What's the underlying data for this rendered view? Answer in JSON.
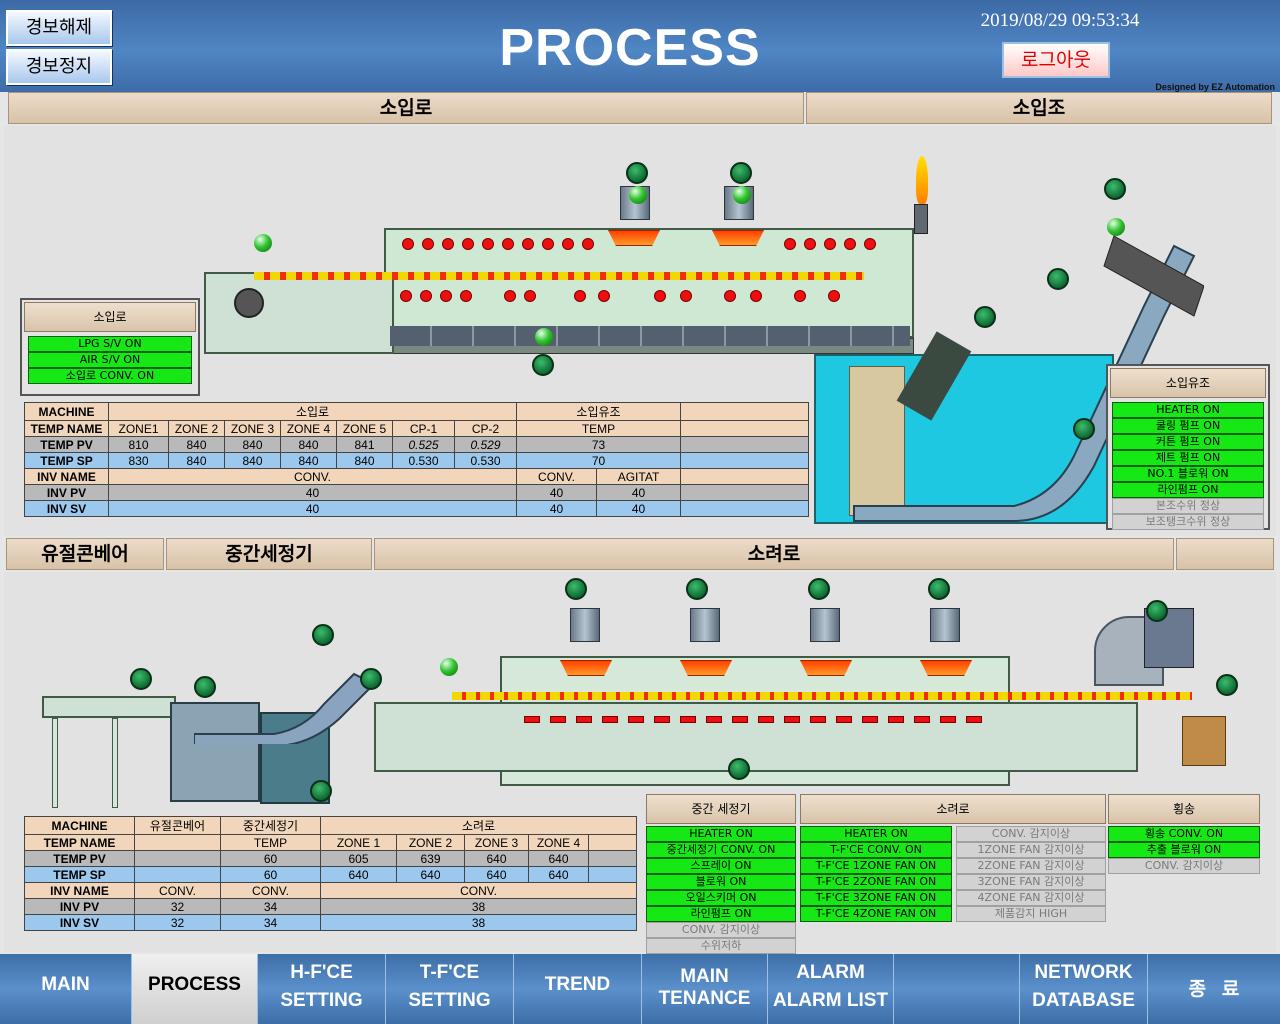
{
  "header": {
    "alarm_reset": "경보해제",
    "alarm_stop": "경보정지",
    "title": "PROCESS",
    "datetime": "2019/08/29 09:53:34",
    "logout": "로그아웃",
    "designed_by": "Designed by EZ Automation"
  },
  "sections": {
    "top_left": "소입로",
    "top_right": "소입조",
    "bottom_1": "유절콘베어",
    "bottom_2": "중간세정기",
    "bottom_3": "소려로"
  },
  "panels": {
    "quench_furnace": {
      "title": "소입로",
      "items": [
        "LPG S/V ON",
        "AIR S/V ON",
        "소입로 CONV. ON"
      ]
    },
    "quench_oil": {
      "title": "소입유조",
      "items_on": [
        "HEATER ON",
        "쿨링 펌프 ON",
        "커튼 펌프 ON",
        "제트 펌프 ON",
        "NO.1 블로워 ON",
        "라인펌프 ON"
      ],
      "items_off": [
        "본조수위 정상",
        "보조탱크수위 정상"
      ]
    },
    "washer": {
      "title": "중간 세정기",
      "items_on": [
        "HEATER ON",
        "중간세정기 CONV. ON",
        "스프레이 ON",
        "블로워 ON",
        "오일스키머 ON",
        "라인펌프 ON"
      ],
      "items_off": [
        "CONV. 감지이상",
        "수위저하"
      ]
    },
    "temper": {
      "title": "소려로",
      "items_on": [
        "HEATER ON",
        "T-F'CE CONV. ON",
        "T-F'CE 1ZONE FAN ON",
        "T-F'CE 2ZONE FAN ON",
        "T-F'CE 3ZONE FAN ON",
        "T-F'CE 4ZONE FAN ON"
      ],
      "items_off": [
        "CONV. 감지이상",
        "1ZONE FAN 감지이상",
        "2ZONE FAN 감지이상",
        "3ZONE FAN 감지이상",
        "4ZONE FAN 감지이상",
        "제품감지 HIGH"
      ]
    },
    "transfer": {
      "title": "횡송",
      "items_on": [
        "횡송 CONV. ON",
        "추출 블로워 ON"
      ],
      "items_off": [
        "CONV. 감지이상"
      ]
    }
  },
  "top_table": {
    "machine": "MACHINE",
    "group1": "소입로",
    "group2": "소입유조",
    "temp_name": "TEMP NAME",
    "zones": [
      "ZONE1",
      "ZONE 2",
      "ZONE 3",
      "ZONE 4",
      "ZONE 5",
      "CP-1",
      "CP-2"
    ],
    "temp_label": "TEMP",
    "temp_pv_label": "TEMP PV",
    "temp_pv": [
      "810",
      "840",
      "840",
      "840",
      "841",
      "0.525",
      "0.529"
    ],
    "temp_pv_oil": "73",
    "temp_sp_label": "TEMP SP",
    "temp_sp": [
      "830",
      "840",
      "840",
      "840",
      "840",
      "0.530",
      "0.530"
    ],
    "temp_sp_oil": "70",
    "inv_name": "INV NAME",
    "conv": "CONV.",
    "agitat": "AGITAT",
    "inv_pv_label": "INV PV",
    "inv_pv": [
      "40",
      "40",
      "40"
    ],
    "inv_sv_label": "INV SV",
    "inv_sv": [
      "40",
      "40",
      "40"
    ]
  },
  "bottom_table": {
    "machine": "MACHINE",
    "col1": "유절콘베어",
    "col2": "중간세정기",
    "col3": "소려로",
    "temp_name": "TEMP NAME",
    "temp_label": "TEMP",
    "zones": [
      "ZONE 1",
      "ZONE 2",
      "ZONE 3",
      "ZONE 4"
    ],
    "temp_pv_label": "TEMP PV",
    "temp_pv_wash": "60",
    "temp_pv": [
      "605",
      "639",
      "640",
      "640"
    ],
    "temp_sp_label": "TEMP SP",
    "temp_sp_wash": "60",
    "temp_sp": [
      "640",
      "640",
      "640",
      "640"
    ],
    "inv_name": "INV NAME",
    "conv": "CONV.",
    "inv_pv_label": "INV PV",
    "inv_pv": [
      "32",
      "34",
      "38"
    ],
    "inv_sv_label": "INV SV",
    "inv_sv": [
      "32",
      "34",
      "38"
    ]
  },
  "nav": {
    "main": "MAIN",
    "process": "PROCESS",
    "hfce_1": "H-F'CE",
    "hfce_2": "SETTING",
    "tfce_1": "T-F'CE",
    "tfce_2": "SETTING",
    "trend": "TREND",
    "maint_1": "MAIN",
    "maint_2": "TENANCE",
    "alarm_1": "ALARM",
    "alarm_2": "ALARM LIST",
    "network_1": "NETWORK",
    "network_2": "DATABASE",
    "exit": "종   료"
  }
}
